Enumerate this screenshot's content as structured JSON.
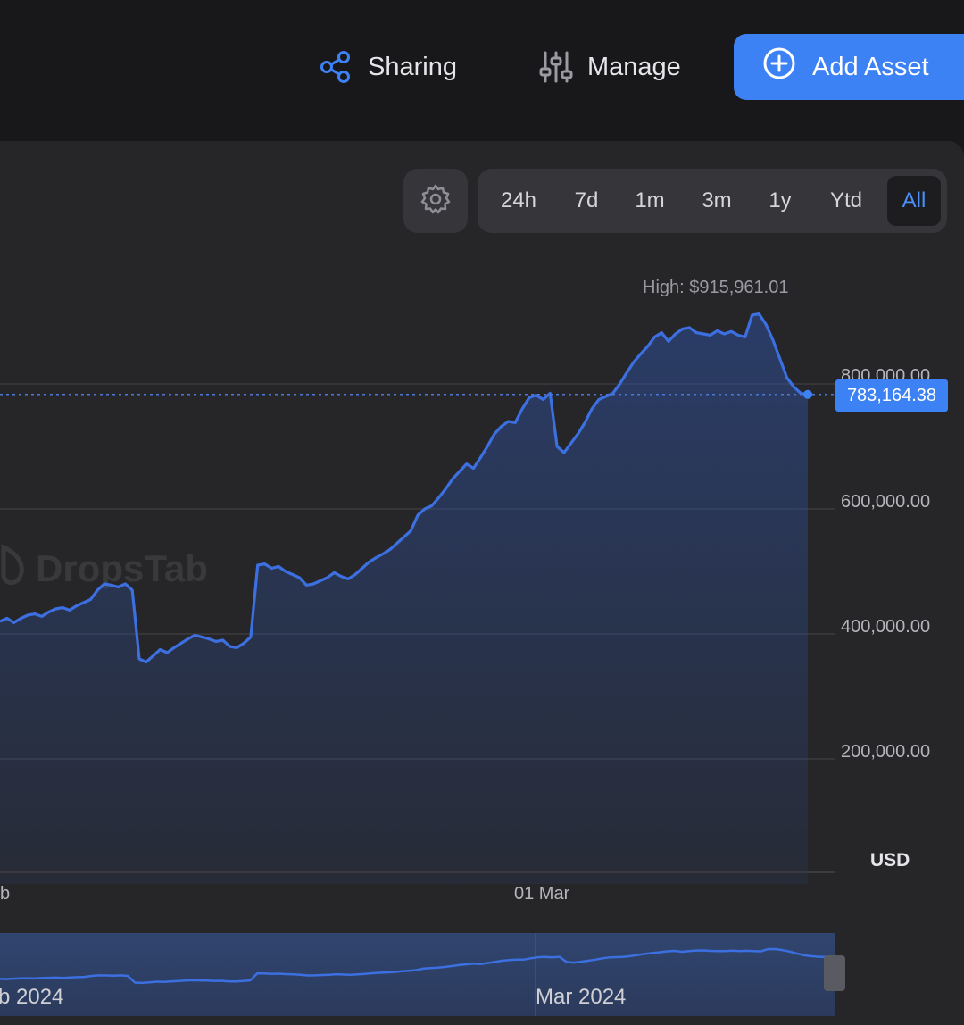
{
  "header": {
    "sharing_label": "Sharing",
    "manage_label": "Manage",
    "add_asset_label": "Add Asset",
    "icons": {
      "sharing": "share-icon",
      "manage": "sliders-icon",
      "add_asset": "plus-circle-icon",
      "settings": "gear-icon"
    }
  },
  "range": {
    "options": [
      "24h",
      "7d",
      "1m",
      "3m",
      "1y",
      "Ytd",
      "All"
    ],
    "selected": "All"
  },
  "watermark": "DropsTab",
  "colors": {
    "accent": "#3d82f5",
    "line": "#3c6fe0",
    "background": "#262629"
  },
  "chart_data": {
    "type": "area",
    "currency": "USD",
    "high_label": "High: $915,961.01",
    "current_label": "783,164.38",
    "y_ticks": [
      "200,000.00",
      "400,000.00",
      "600,000.00",
      "800,000.00"
    ],
    "x_ticks": [
      "b",
      "01 Mar"
    ],
    "navigator_labels": [
      "b 2024",
      "Mar 2024"
    ],
    "grid": true,
    "ylim": [
      0,
      1000000
    ],
    "series": [
      {
        "values": [
          420000,
          425000,
          418000,
          425000,
          430000,
          432000,
          428000,
          435000,
          440000,
          442000,
          438000,
          445000,
          450000,
          455000,
          470000,
          480000,
          478000,
          475000,
          480000,
          470000,
          360000,
          355000,
          365000,
          375000,
          370000,
          378000,
          385000,
          392000,
          398000,
          395000,
          392000,
          388000,
          390000,
          380000,
          378000,
          385000,
          395000,
          510000,
          512000,
          505000,
          508000,
          500000,
          495000,
          490000,
          478000,
          480000,
          485000,
          490000,
          498000,
          492000,
          488000,
          495000,
          505000,
          515000,
          522000,
          528000,
          535000,
          545000,
          555000,
          565000,
          590000,
          600000,
          605000,
          618000,
          632000,
          648000,
          660000,
          672000,
          665000,
          682000,
          700000,
          720000,
          732000,
          740000,
          738000,
          760000,
          778000,
          782000,
          775000,
          785000,
          700000,
          690000,
          705000,
          720000,
          738000,
          760000,
          775000,
          780000,
          785000,
          800000,
          818000,
          835000,
          848000,
          860000,
          875000,
          882000,
          868000,
          880000,
          888000,
          890000,
          882000,
          880000,
          878000,
          885000,
          880000,
          884000,
          878000,
          875000,
          910000,
          912000,
          895000,
          870000,
          840000,
          810000,
          795000,
          785000,
          783164
        ]
      }
    ]
  }
}
